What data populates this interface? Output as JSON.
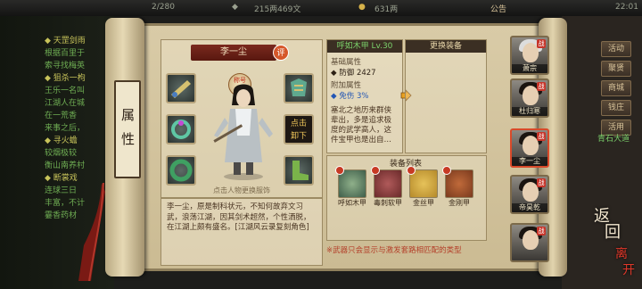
{
  "topbar": {
    "stat1": "2/280",
    "stat2": "215两469文",
    "stat3": "631两",
    "notice": "公告",
    "time": "22:01"
  },
  "quest": {
    "items": [
      {
        "text": "◆ 天罡剑雨",
        "head": true
      },
      {
        "text": "根据百里于",
        "head": false
      },
      {
        "text": "索寻找梅英",
        "head": false
      },
      {
        "text": "◆ 狙杀一枸",
        "head": true
      },
      {
        "text": "王乐一名叫",
        "head": false
      },
      {
        "text": "江湖人在城",
        "head": false
      },
      {
        "text": "在一荒香",
        "head": false
      },
      {
        "text": "来事之后，",
        "head": false
      },
      {
        "text": "◆ 寻火蟾",
        "head": true
      },
      {
        "text": "较烟极较",
        "head": false
      },
      {
        "text": "衡山南养村",
        "head": false
      },
      {
        "text": "◆ 断裳戏",
        "head": true
      },
      {
        "text": "连球三日",
        "head": false
      },
      {
        "text": "丰富，不计",
        "head": false
      },
      {
        "text": "霎香药材",
        "head": false
      }
    ]
  },
  "rmenu": {
    "buttons": [
      "活动",
      "聚贤",
      "商城",
      "钱庄",
      "活用"
    ],
    "location": "青石大道"
  },
  "tab": {
    "label": "属性"
  },
  "character": {
    "name": "李一尘",
    "rank_badge": "评",
    "title_badge": "称号",
    "unequip_label": "点击\n卸下",
    "hint": "点击人物更换服饰",
    "description": "李一尘，原是制科状元，不知何故弃文习武，浪荡江湖，因其剑术超然，个性洒脱，在江湖上颇有盛名。[江湖风云录复刻角色]"
  },
  "equipment": {
    "title": "呼如木甲 Lv.30",
    "base_label": "基础属性",
    "base_value": "◆ 防御 2427",
    "extra_label": "附加属性",
    "extra_value": "◆ 免伤 3%",
    "flavor": "塞北之地历来群侠辈出，多是追求极度的武学高人，这件宝甲也是出自…"
  },
  "change": {
    "title": "更换装备"
  },
  "list": {
    "title": "装备列表",
    "items": [
      {
        "name": "呼如木甲",
        "color": "#3f5e4a"
      },
      {
        "name": "毒刺软甲",
        "color": "#6a2a2a"
      },
      {
        "name": "金丝甲",
        "color": "#b58a2a"
      },
      {
        "name": "金刚甲",
        "color": "#7a3a1e"
      }
    ],
    "note": "※武器只会显示与激发套路相匹配的类型"
  },
  "portraits": [
    {
      "name": "萧宗",
      "badge": "战"
    },
    {
      "name": "杜归寒",
      "badge": "战"
    },
    {
      "name": "李一尘",
      "badge": "战"
    },
    {
      "name": "帝昊乾",
      "badge": "战"
    },
    {
      "name": "",
      "badge": "战"
    }
  ],
  "back": {
    "line1": "返",
    "line2": "回",
    "line3": "离",
    "line4": "开"
  }
}
